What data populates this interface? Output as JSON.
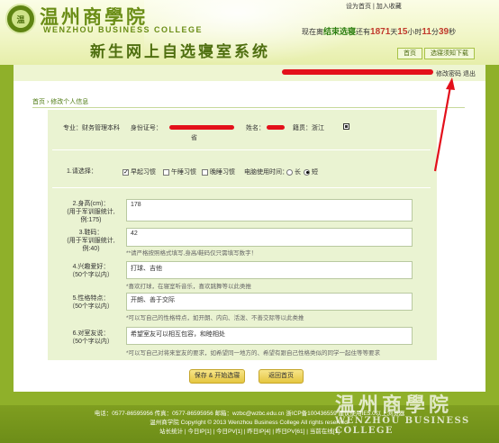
{
  "header": {
    "school_name_cn": "温州商學院",
    "school_name_en": "WENZHOU BUSINESS COLLEGE",
    "logo_text": "温",
    "system_title": "新生网上自选寝室系统",
    "top_links": {
      "home": "设为首页",
      "sep": " | ",
      "favorite": "加入收藏"
    },
    "countdown": {
      "prefix": "现在离",
      "event": "结束选寝",
      "mid": "还有",
      "days": "1871",
      "days_unit": "天",
      "hours": "15",
      "hours_unit": "小时",
      "minutes": "11",
      "minutes_unit": "分",
      "seconds": "39",
      "seconds_unit": "秒"
    },
    "nav": {
      "home": "首页",
      "notice": "选寝须知下载"
    }
  },
  "user_bar": {
    "change_password": "修改密码",
    "logout": "退出"
  },
  "breadcrumb": {
    "home": "首页",
    "sep": " › ",
    "current": "修改个人信息"
  },
  "student": {
    "major_label": "专业：财务管理本科",
    "id_label": "身份证号：",
    "name_label": "姓名：",
    "origin_label": "籍贯：浙江",
    "origin_tail": "省"
  },
  "form": {
    "habits": {
      "label": "1.请选择：",
      "early": "早起习惯",
      "nap": "午睡习惯",
      "late": "晚睡习惯",
      "pc_label": "电脑使用时间：",
      "long": "长",
      "short": "短"
    },
    "height": {
      "label": "2.身高(cm)：",
      "note": "(用于军训服统计,",
      "example": "例:175)",
      "value": "178"
    },
    "shoe": {
      "label": "3.鞋码：",
      "note": "(用于军训服统计,",
      "example": "例:40)",
      "value": "42",
      "hint": "**请严格按照格式填写,身高/鞋码仅只需填写数字！"
    },
    "hobby": {
      "label": "4.兴趣爱好：",
      "limit": "（50个字以内）",
      "value": "打球、吉他",
      "hint": "*喜欢打球，在寝室听音乐，喜欢跳舞等以此类推"
    },
    "trait": {
      "label": "5.性格特点：",
      "limit": "（50个字以内）",
      "value": "开朗、善于交际",
      "hint": "*可以写自己的性格特点，如开朗、内向、活泼、不善交际等以此类推"
    },
    "friend": {
      "label": "6.对室友说：",
      "limit": "（50个字以内）",
      "value": "希望室友可以相互包容，和睦相处",
      "hint": "*可以写自己对将来室友的要求，如希望同一地方的、希望有跟自己性格类似的同学一起住等等要求"
    }
  },
  "buttons": {
    "save": "保存 & 开始选寝",
    "back": "返回首页"
  },
  "footer": {
    "line1": "电话：0577-86595956 传真：0577-86595956 邮箱：wzbc@wzbc.edu.cn 浙ICP备100436559 建议使用IE5.0以上浏览器",
    "line2": "温州商学院 Copyright © 2013 Wenzhou Business College All rights reserved.",
    "line3": "站长统计 | 今日IP[1] | 今日PV[1] | 昨日IP[4] | 昨日PV[61] | 当前在线[1]"
  },
  "watermark": {
    "cn": "温州商學院",
    "en": "WENZHOU BUSINESS COLLEGE"
  },
  "colors": {
    "theme_green": "#8fb02a",
    "accent_red": "#e3101b"
  },
  "icons": {
    "logo": "school-emblem-icon",
    "checkbox": "checkbox-icon",
    "radio": "radio-icon"
  }
}
